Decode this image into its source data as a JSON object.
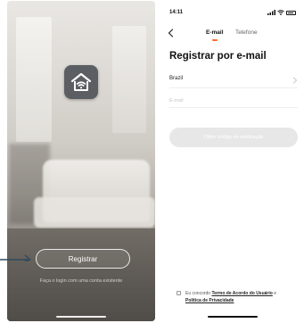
{
  "welcome": {
    "register_label": "Registrar",
    "login_text": "Faça o login com uma conta existente"
  },
  "register_email": {
    "status_time": "14:11",
    "tabs": [
      {
        "label": "E-mail",
        "active": true
      },
      {
        "label": "Telefone",
        "active": false
      }
    ],
    "title": "Registrar por e-mail",
    "country": "Brazil",
    "email_placeholder": "E-mail",
    "get_code_label": "Obter código de verificação",
    "terms": {
      "prefix": "Eu concordo",
      "terms_link": "Termo de Acordo do Usuário",
      "conjunction": "e",
      "privacy_link": "Política de Privacidade"
    }
  },
  "colors": {
    "accent": "#ff6b2b",
    "button_disabled": "#e7e7e7",
    "logo_bg": "#5b5f63"
  },
  "icons": {
    "app_logo": "home-wifi-icon",
    "back": "chevron-left-icon",
    "country_chevron": "chevron-right-icon",
    "pointer": "arrow-right-icon"
  }
}
